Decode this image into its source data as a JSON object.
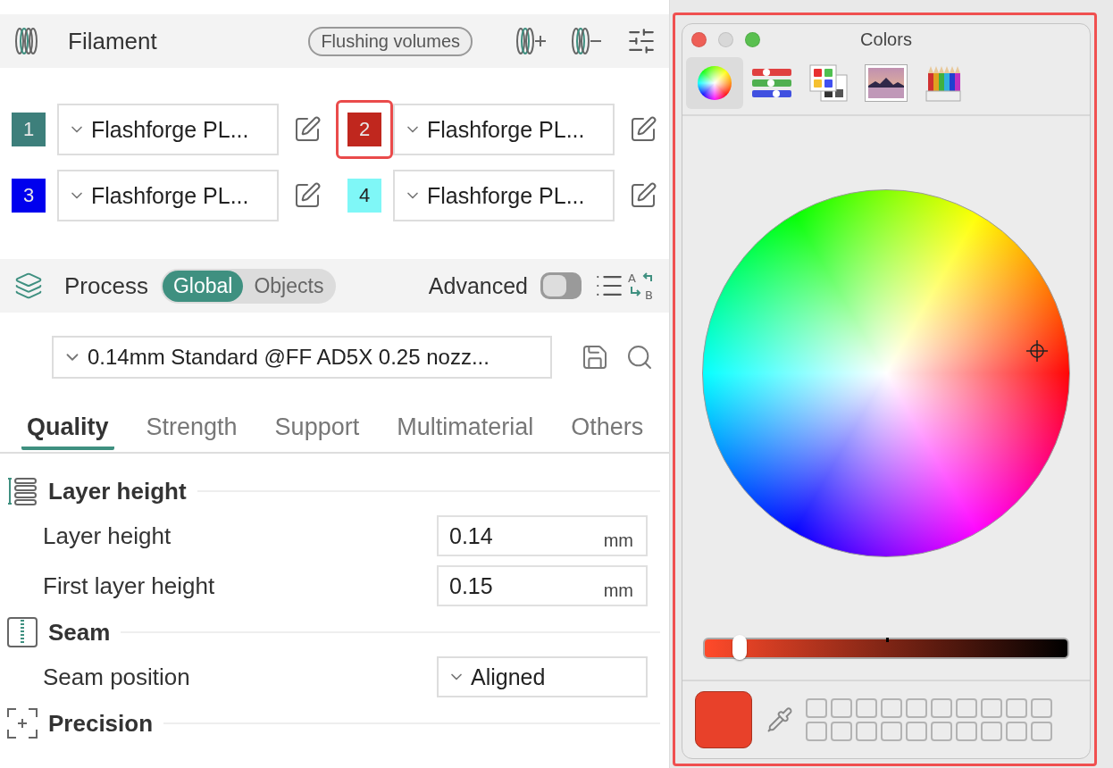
{
  "filament": {
    "title": "Filament",
    "flushing_button": "Flushing volumes",
    "slots": [
      {
        "number": "1",
        "color": "#3d7f7b",
        "selected": false,
        "preset": "Flashforge PL..."
      },
      {
        "number": "2",
        "color": "#c0271e",
        "selected": true,
        "preset": "Flashforge PL..."
      },
      {
        "number": "3",
        "color": "#0000ee",
        "selected": false,
        "preset": "Flashforge PL..."
      },
      {
        "number": "4",
        "color": "#7ff7f7",
        "selected": false,
        "preset": "Flashforge PL..."
      }
    ]
  },
  "process": {
    "title": "Process",
    "scope": [
      {
        "label": "Global",
        "selected": true
      },
      {
        "label": "Objects",
        "selected": false
      }
    ],
    "advanced": {
      "label": "Advanced",
      "on": false
    },
    "compare_letters": [
      "A",
      "B"
    ],
    "preset": "0.14mm Standard @FF AD5X 0.25 nozz...",
    "tabs": [
      {
        "label": "Quality",
        "selected": true
      },
      {
        "label": "Strength",
        "selected": false
      },
      {
        "label": "Support",
        "selected": false
      },
      {
        "label": "Multimaterial",
        "selected": false
      },
      {
        "label": "Others",
        "selected": false
      }
    ],
    "sections": [
      {
        "title": "Layer height",
        "options": [
          {
            "kind": "number",
            "label": "Layer height",
            "value": "0.14",
            "unit": "mm"
          },
          {
            "kind": "number",
            "label": "First layer height",
            "value": "0.15",
            "unit": "mm"
          }
        ]
      },
      {
        "title": "Seam",
        "options": [
          {
            "kind": "select",
            "label": "Seam position",
            "value": "Aligned"
          }
        ]
      },
      {
        "title": "Precision"
      }
    ]
  },
  "colors_window": {
    "title": "Colors",
    "modes": [
      {
        "selected": true
      },
      {
        "selected": false
      },
      {
        "selected": false
      },
      {
        "selected": false
      },
      {
        "selected": false
      }
    ],
    "brightness": {
      "level": 0.095
    },
    "current_swatch": {
      "color": "#e8412a"
    }
  }
}
